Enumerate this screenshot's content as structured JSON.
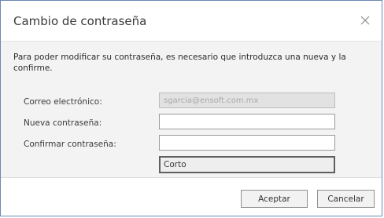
{
  "dialog": {
    "title": "Cambio de contraseña",
    "close_icon": "close-icon"
  },
  "message": "Para poder modificar su contraseña, es necesario que introduzca una nueva y la confirme.",
  "form": {
    "email_label": "Correo electrónico:",
    "email_value": "sgarcia@ensoft.com.mx",
    "new_password_label": "Nueva contraseña:",
    "new_password_value": "",
    "confirm_password_label": "Confirmar contraseña:",
    "confirm_password_value": "",
    "strength_text": "Corto"
  },
  "buttons": {
    "accept": "Aceptar",
    "cancel": "Cancelar"
  }
}
